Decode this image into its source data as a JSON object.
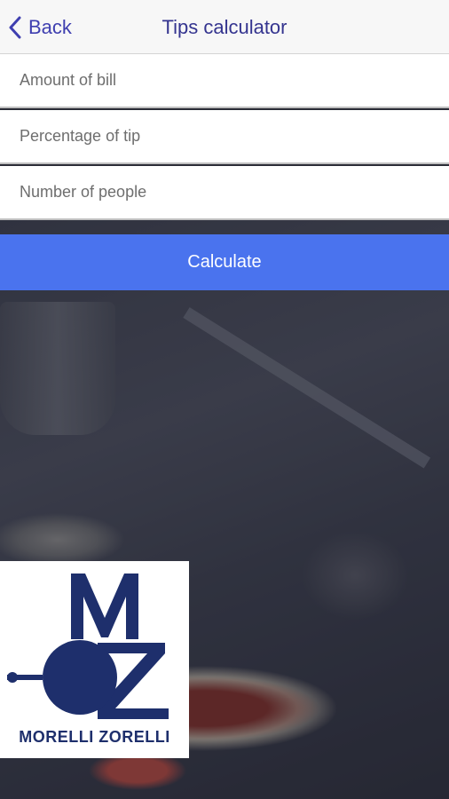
{
  "header": {
    "back_label": "Back",
    "title": "Tips calculator"
  },
  "form": {
    "amount_placeholder": "Amount of bill",
    "percentage_placeholder": "Percentage of tip",
    "people_placeholder": "Number of people",
    "calculate_label": "Calculate"
  },
  "logo": {
    "name": "MORELLI ZORELLI",
    "letters": "MZ"
  },
  "colors": {
    "accent": "#4a73ee",
    "header_text": "#34348f",
    "logo_blue": "#1e2f6c"
  },
  "icons": {
    "back": "chevron-left-icon"
  }
}
